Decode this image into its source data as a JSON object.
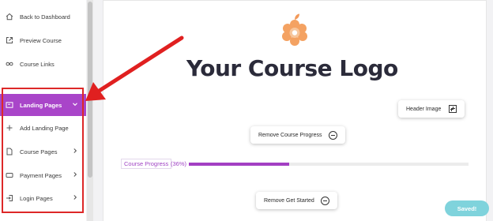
{
  "sidebar": {
    "items": [
      {
        "label": "Back to Dashboard",
        "icon": "home-icon"
      },
      {
        "label": "Preview Course",
        "icon": "external-link-icon"
      },
      {
        "label": "Course Links",
        "icon": "link-icon"
      },
      {
        "label": "Landing Pages",
        "icon": "page-icon",
        "active": true,
        "expanded": true
      },
      {
        "label": "Add Landing Page",
        "icon": "plus-icon"
      },
      {
        "label": "Course Pages",
        "icon": "document-icon"
      },
      {
        "label": "Payment Pages",
        "icon": "card-icon"
      },
      {
        "label": "Login Pages",
        "icon": "login-icon"
      }
    ]
  },
  "canvas": {
    "logo_text": "Your Course Logo",
    "header_image_label": "Header Image",
    "remove_progress_label": "Remove Course Progress",
    "progress": {
      "label": "Course Progress",
      "percent_text": "(36%)",
      "value": 0.36
    },
    "remove_get_started_label": "Remove Get Started"
  },
  "saved_label": "Saved!",
  "colors": {
    "accent": "#a945c9",
    "highlight": "#dd2828",
    "saved": "#7fd3dc",
    "logo_flower": "#f2995a"
  }
}
